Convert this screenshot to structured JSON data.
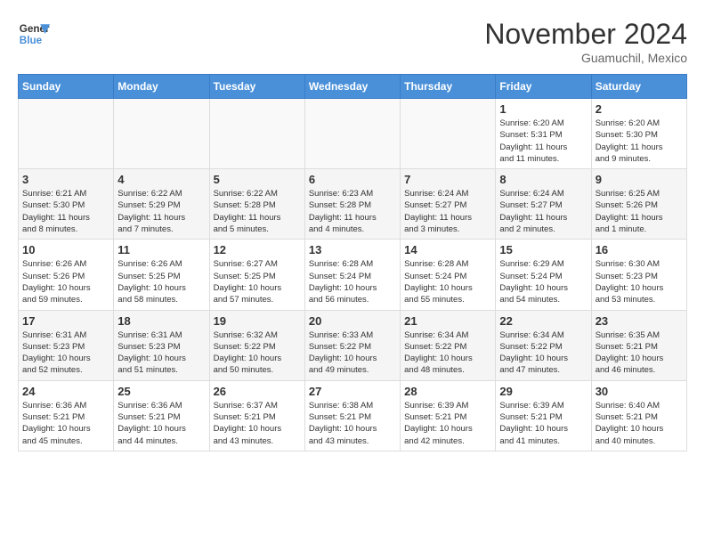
{
  "header": {
    "logo_line1": "General",
    "logo_line2": "Blue",
    "month": "November 2024",
    "location": "Guamuchil, Mexico"
  },
  "weekdays": [
    "Sunday",
    "Monday",
    "Tuesday",
    "Wednesday",
    "Thursday",
    "Friday",
    "Saturday"
  ],
  "weeks": [
    [
      {
        "day": "",
        "info": ""
      },
      {
        "day": "",
        "info": ""
      },
      {
        "day": "",
        "info": ""
      },
      {
        "day": "",
        "info": ""
      },
      {
        "day": "",
        "info": ""
      },
      {
        "day": "1",
        "info": "Sunrise: 6:20 AM\nSunset: 5:31 PM\nDaylight: 11 hours\nand 11 minutes."
      },
      {
        "day": "2",
        "info": "Sunrise: 6:20 AM\nSunset: 5:30 PM\nDaylight: 11 hours\nand 9 minutes."
      }
    ],
    [
      {
        "day": "3",
        "info": "Sunrise: 6:21 AM\nSunset: 5:30 PM\nDaylight: 11 hours\nand 8 minutes."
      },
      {
        "day": "4",
        "info": "Sunrise: 6:22 AM\nSunset: 5:29 PM\nDaylight: 11 hours\nand 7 minutes."
      },
      {
        "day": "5",
        "info": "Sunrise: 6:22 AM\nSunset: 5:28 PM\nDaylight: 11 hours\nand 5 minutes."
      },
      {
        "day": "6",
        "info": "Sunrise: 6:23 AM\nSunset: 5:28 PM\nDaylight: 11 hours\nand 4 minutes."
      },
      {
        "day": "7",
        "info": "Sunrise: 6:24 AM\nSunset: 5:27 PM\nDaylight: 11 hours\nand 3 minutes."
      },
      {
        "day": "8",
        "info": "Sunrise: 6:24 AM\nSunset: 5:27 PM\nDaylight: 11 hours\nand 2 minutes."
      },
      {
        "day": "9",
        "info": "Sunrise: 6:25 AM\nSunset: 5:26 PM\nDaylight: 11 hours\nand 1 minute."
      }
    ],
    [
      {
        "day": "10",
        "info": "Sunrise: 6:26 AM\nSunset: 5:26 PM\nDaylight: 10 hours\nand 59 minutes."
      },
      {
        "day": "11",
        "info": "Sunrise: 6:26 AM\nSunset: 5:25 PM\nDaylight: 10 hours\nand 58 minutes."
      },
      {
        "day": "12",
        "info": "Sunrise: 6:27 AM\nSunset: 5:25 PM\nDaylight: 10 hours\nand 57 minutes."
      },
      {
        "day": "13",
        "info": "Sunrise: 6:28 AM\nSunset: 5:24 PM\nDaylight: 10 hours\nand 56 minutes."
      },
      {
        "day": "14",
        "info": "Sunrise: 6:28 AM\nSunset: 5:24 PM\nDaylight: 10 hours\nand 55 minutes."
      },
      {
        "day": "15",
        "info": "Sunrise: 6:29 AM\nSunset: 5:24 PM\nDaylight: 10 hours\nand 54 minutes."
      },
      {
        "day": "16",
        "info": "Sunrise: 6:30 AM\nSunset: 5:23 PM\nDaylight: 10 hours\nand 53 minutes."
      }
    ],
    [
      {
        "day": "17",
        "info": "Sunrise: 6:31 AM\nSunset: 5:23 PM\nDaylight: 10 hours\nand 52 minutes."
      },
      {
        "day": "18",
        "info": "Sunrise: 6:31 AM\nSunset: 5:23 PM\nDaylight: 10 hours\nand 51 minutes."
      },
      {
        "day": "19",
        "info": "Sunrise: 6:32 AM\nSunset: 5:22 PM\nDaylight: 10 hours\nand 50 minutes."
      },
      {
        "day": "20",
        "info": "Sunrise: 6:33 AM\nSunset: 5:22 PM\nDaylight: 10 hours\nand 49 minutes."
      },
      {
        "day": "21",
        "info": "Sunrise: 6:34 AM\nSunset: 5:22 PM\nDaylight: 10 hours\nand 48 minutes."
      },
      {
        "day": "22",
        "info": "Sunrise: 6:34 AM\nSunset: 5:22 PM\nDaylight: 10 hours\nand 47 minutes."
      },
      {
        "day": "23",
        "info": "Sunrise: 6:35 AM\nSunset: 5:21 PM\nDaylight: 10 hours\nand 46 minutes."
      }
    ],
    [
      {
        "day": "24",
        "info": "Sunrise: 6:36 AM\nSunset: 5:21 PM\nDaylight: 10 hours\nand 45 minutes."
      },
      {
        "day": "25",
        "info": "Sunrise: 6:36 AM\nSunset: 5:21 PM\nDaylight: 10 hours\nand 44 minutes."
      },
      {
        "day": "26",
        "info": "Sunrise: 6:37 AM\nSunset: 5:21 PM\nDaylight: 10 hours\nand 43 minutes."
      },
      {
        "day": "27",
        "info": "Sunrise: 6:38 AM\nSunset: 5:21 PM\nDaylight: 10 hours\nand 43 minutes."
      },
      {
        "day": "28",
        "info": "Sunrise: 6:39 AM\nSunset: 5:21 PM\nDaylight: 10 hours\nand 42 minutes."
      },
      {
        "day": "29",
        "info": "Sunrise: 6:39 AM\nSunset: 5:21 PM\nDaylight: 10 hours\nand 41 minutes."
      },
      {
        "day": "30",
        "info": "Sunrise: 6:40 AM\nSunset: 5:21 PM\nDaylight: 10 hours\nand 40 minutes."
      }
    ]
  ]
}
